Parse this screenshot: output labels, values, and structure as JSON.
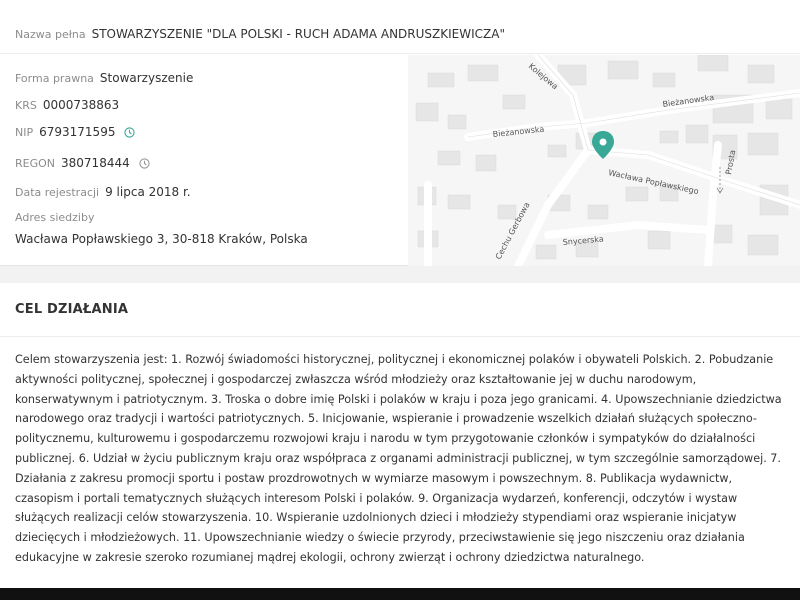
{
  "entity": {
    "full_name_label": "Nazwa pełna",
    "full_name": "STOWARZYSZENIE \"DLA POLSKI - RUCH ADAMA ANDRUSZKIEWICZA\"",
    "legal_form_label": "Forma prawna",
    "legal_form": "Stowarzyszenie",
    "krs_label": "KRS",
    "krs": "0000738863",
    "nip_label": "NIP",
    "nip": "6793171595",
    "regon_label": "REGON",
    "regon": "380718444",
    "reg_date_label": "Data rejestracji",
    "reg_date": "9 lipca 2018 r.",
    "address_label": "Adres siedziby",
    "address": "Wacława Popławskiego 3, 30-818 Kraków, Polska"
  },
  "map": {
    "streets": [
      "Kolejowa",
      "Bieżanowska",
      "Bieżanowska",
      "Wacława Popławskiego",
      "Prosta",
      "Snycerska",
      "Cechu Gerbowa"
    ],
    "pin_color": "#3aa896"
  },
  "goal": {
    "title": "CEL DZIAŁANIA",
    "text": "Celem stowarzyszenia jest: 1. Rozwój świadomości historycznej, politycznej i ekonomicznej polaków i obywateli Polskich. 2. Pobudzanie aktywności politycznej, społecznej i gospodarczej zwłaszcza wśród młodzieży oraz kształtowanie jej w duchu narodowym, konserwatywnym i patriotycznym. 3. Troska o dobre imię Polski i polaków w kraju i poza jego granicami. 4. Upowszechnianie dziedzictwa narodowego oraz tradycji i wartości patriotycznych. 5. Inicjowanie, wspieranie i prowadzenie wszelkich działań służących społeczno- politycznemu, kulturowemu i gospodarczemu rozwojowi kraju i narodu w tym przygotowanie członków i sympatyków do działalności publicznej. 6. Udział w życiu publicznym kraju oraz współpraca z organami administracji publicznej, w tym szczególnie samorządowej. 7. Działania z zakresu promocji sportu i postaw prozdrowotnych w wymiarze masowym i powszechnym. 8. Publikacja wydawnictw, czasopism i portali tematycznych służących interesom Polski i polaków. 9. Organizacja wydarzeń, konferencji, odczytów i wystaw służących realizacji celów stowarzyszenia. 10. Wspieranie uzdolnionych dzieci i młodzieży stypendiami oraz wspieranie inicjatyw dziecięcych i młodzieżowych. 11. Upowszechnianie wiedzy o świecie przyrody, przeciwstawienie się jego niszczeniu oraz działania edukacyjne w zakresie szeroko rozumianej mądrej ekologii, ochrony zwierząt i ochrony dziedzictwa naturalnego."
  },
  "icons": {
    "nip_status": "clock-icon",
    "regon_status": "clock-icon",
    "status_color": "#3aa896",
    "regon_icon_color": "#999999"
  }
}
